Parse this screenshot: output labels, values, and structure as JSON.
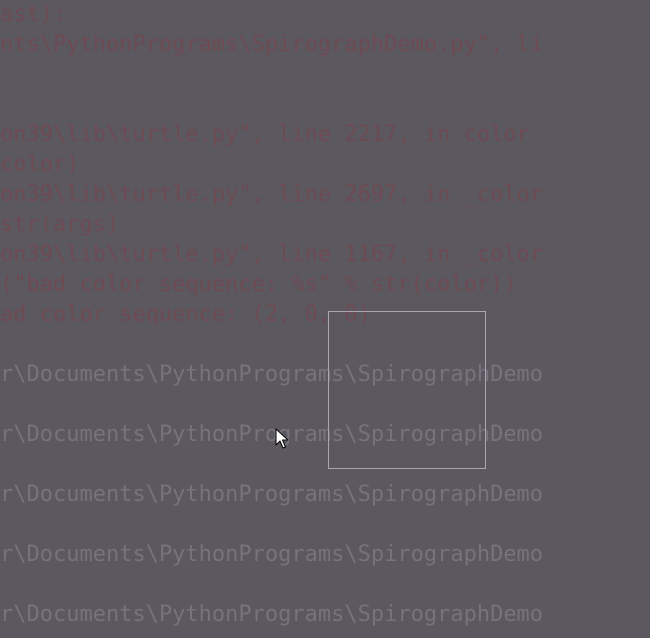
{
  "console": {
    "lines": [
      {
        "text": "ast):",
        "kind": "error"
      },
      {
        "text": "nts\\PythonPrograms\\SpirographDemo.py\", li",
        "kind": "error"
      },
      {
        "text": "",
        "kind": "error"
      },
      {
        "text": "",
        "kind": "error"
      },
      {
        "text": "on39\\lib\\turtle.py\", line 2217, in color",
        "kind": "error"
      },
      {
        "text": "color)",
        "kind": "error"
      },
      {
        "text": "on39\\lib\\turtle.py\", line 2697, in _color",
        "kind": "error"
      },
      {
        "text": "str(args)",
        "kind": "error"
      },
      {
        "text": "on39\\lib\\turtle.py\", line 1167, in _color",
        "kind": "error"
      },
      {
        "text": "(\"bad color sequence: %s\" % str(color))",
        "kind": "error"
      },
      {
        "text": "ad color sequence: (2, 0, 0)",
        "kind": "error"
      },
      {
        "text": "",
        "kind": "path"
      },
      {
        "text": "r\\Documents\\PythonPrograms\\SpirographDemo",
        "kind": "path"
      },
      {
        "text": "",
        "kind": "path"
      },
      {
        "text": "r\\Documents\\PythonPrograms\\SpirographDemo",
        "kind": "path"
      },
      {
        "text": "",
        "kind": "path"
      },
      {
        "text": "r\\Documents\\PythonPrograms\\SpirographDemo",
        "kind": "path"
      },
      {
        "text": "",
        "kind": "path"
      },
      {
        "text": "r\\Documents\\PythonPrograms\\SpirographDemo",
        "kind": "path"
      },
      {
        "text": "",
        "kind": "path"
      },
      {
        "text": "r\\Documents\\PythonPrograms\\SpirographDemo",
        "kind": "path"
      }
    ]
  },
  "colors": {
    "background": "#5b5860",
    "error_text": "#6e4b53",
    "path_text": "#77727b",
    "selection_border": "#a9a5b3"
  },
  "icons": {
    "cursor": "mouse-pointer-icon"
  }
}
